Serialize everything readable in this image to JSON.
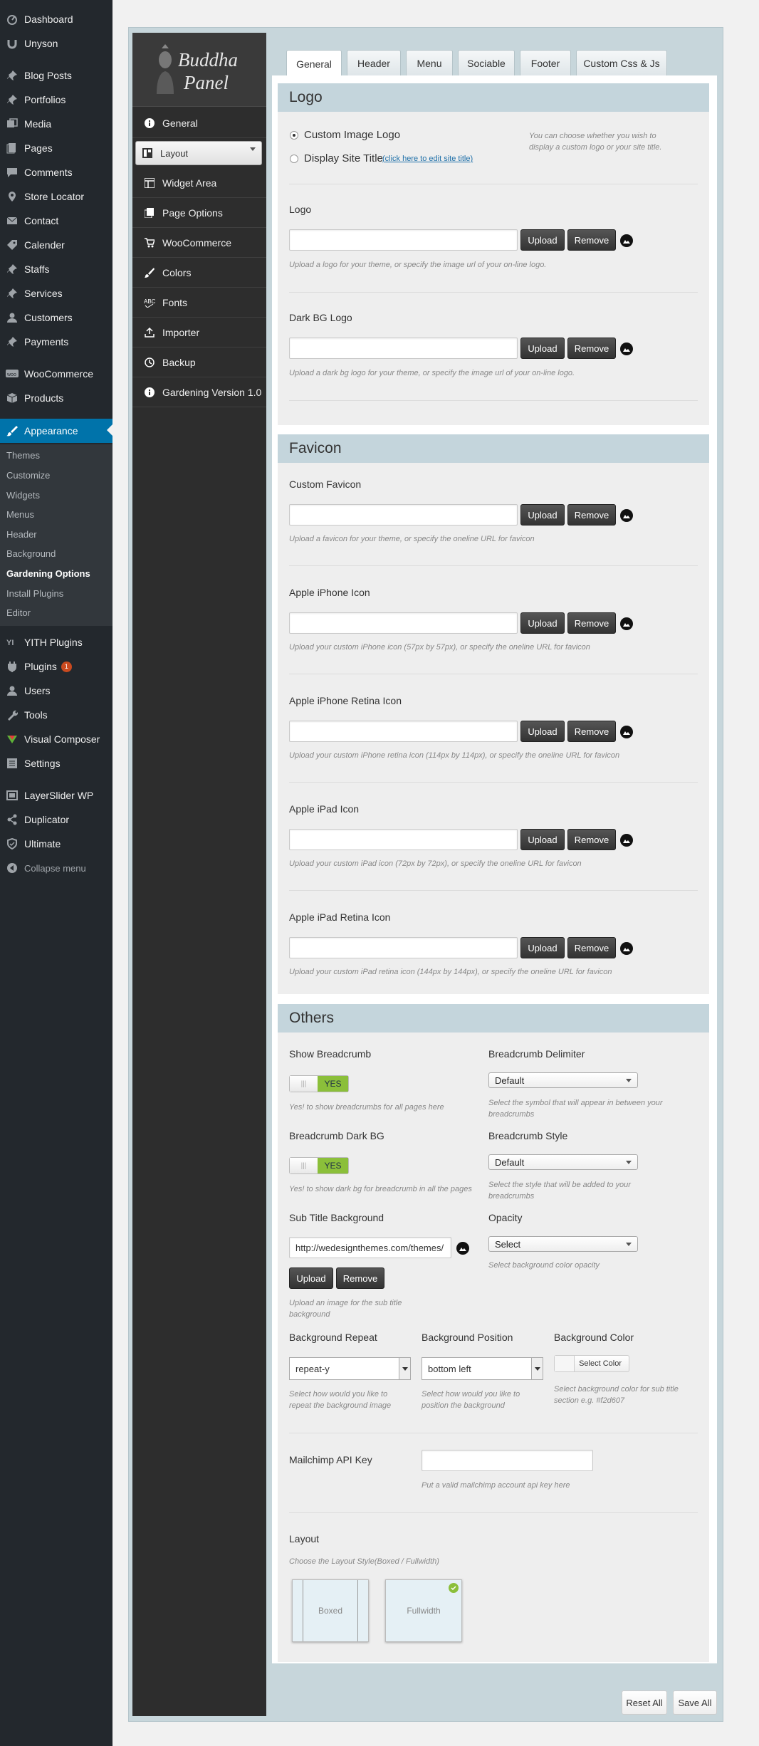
{
  "wp_menu": {
    "items": [
      {
        "label": "Dashboard",
        "icon": "dashboard-icon"
      },
      {
        "label": "Unyson",
        "icon": "unyson-icon"
      },
      {
        "label": "Blog Posts",
        "icon": "pin-icon"
      },
      {
        "label": "Portfolios",
        "icon": "portfolio-icon"
      },
      {
        "label": "Media",
        "icon": "media-icon"
      },
      {
        "label": "Pages",
        "icon": "pages-icon"
      },
      {
        "label": "Comments",
        "icon": "comments-icon"
      },
      {
        "label": "Store Locator",
        "icon": "location-icon"
      },
      {
        "label": "Contact",
        "icon": "email-icon"
      },
      {
        "label": "Calender",
        "icon": "tag-icon"
      },
      {
        "label": "Staffs",
        "icon": "pin-icon"
      },
      {
        "label": "Services",
        "icon": "pin-icon"
      },
      {
        "label": "Customers",
        "icon": "users-icon"
      },
      {
        "label": "Payments",
        "icon": "pin-icon"
      },
      {
        "label": "WooCommerce",
        "icon": "woocommerce-icon"
      },
      {
        "label": "Products",
        "icon": "products-icon"
      },
      {
        "label": "Appearance",
        "icon": "brush-icon"
      }
    ],
    "submenu": [
      "Themes",
      "Customize",
      "Widgets",
      "Menus",
      "Header",
      "Background",
      "Gardening Options",
      "Install Plugins",
      "Editor"
    ],
    "items_after": [
      {
        "label": "YITH Plugins",
        "icon": "yith-icon"
      },
      {
        "label": "Plugins",
        "icon": "plugins-icon",
        "badge": "1"
      },
      {
        "label": "Users",
        "icon": "users-icon"
      },
      {
        "label": "Tools",
        "icon": "tools-icon"
      },
      {
        "label": "Visual Composer",
        "icon": "visual-composer-icon"
      },
      {
        "label": "Settings",
        "icon": "settings-icon"
      },
      {
        "label": "LayerSlider WP",
        "icon": "layers-icon"
      },
      {
        "label": "Duplicator",
        "icon": "duplicator-icon"
      },
      {
        "label": "Ultimate",
        "icon": "ultimate-icon"
      },
      {
        "label": "Collapse menu",
        "icon": "collapse-icon"
      }
    ]
  },
  "panel": {
    "logo_line1": "Buddha",
    "logo_line2": "Panel",
    "nav": [
      {
        "label": "General",
        "icon": "info-icon"
      },
      {
        "label": "Layout",
        "icon": "layout-icon"
      },
      {
        "label": "Widget Area",
        "icon": "widget-icon"
      },
      {
        "label": "Page Options",
        "icon": "page-icon"
      },
      {
        "label": "WooCommerce",
        "icon": "cart-icon"
      },
      {
        "label": "Colors",
        "icon": "brush-icon"
      },
      {
        "label": "Fonts",
        "icon": "fonts-icon"
      },
      {
        "label": "Importer",
        "icon": "upload-icon"
      },
      {
        "label": "Backup",
        "icon": "backup-icon"
      },
      {
        "label": "Gardening Version 1.0",
        "icon": "info-icon"
      }
    ]
  },
  "tabs": [
    "General",
    "Header",
    "Menu",
    "Sociable",
    "Footer",
    "Custom Css & Js"
  ],
  "logo_section": {
    "title": "Logo",
    "radio1": "Custom Image Logo",
    "radio2": "Display Site Title",
    "radio2_link": "(click here to edit site title)",
    "radio_hint": "You can choose whether you wish to display a custom logo or your site title.",
    "fields": [
      {
        "label": "Logo",
        "hint": "Upload a logo for your theme, or specify the image url of your on-line logo."
      },
      {
        "label": "Dark BG Logo",
        "hint": "Upload a dark bg logo for your theme, or specify the image url of your on-line logo."
      }
    ]
  },
  "buttons": {
    "upload": "Upload",
    "remove": "Remove"
  },
  "favicon_section": {
    "title": "Favicon",
    "fields": [
      {
        "label": "Custom Favicon",
        "hint": "Upload a favicon for your theme, or specify the oneline URL for favicon"
      },
      {
        "label": "Apple iPhone Icon",
        "hint": "Upload your custom iPhone icon (57px by 57px), or specify the oneline URL for favicon"
      },
      {
        "label": "Apple iPhone Retina Icon",
        "hint": "Upload your custom iPhone retina icon (114px by 114px), or specify the oneline URL for favicon"
      },
      {
        "label": "Apple iPad Icon",
        "hint": "Upload your custom iPad icon (72px by 72px), or specify the oneline URL for favicon"
      },
      {
        "label": "Apple iPad Retina Icon",
        "hint": "Upload your custom iPad retina icon (144px by 144px), or specify the oneline URL for favicon"
      }
    ]
  },
  "others": {
    "title": "Others",
    "show_breadcrumb": {
      "label": "Show Breadcrumb",
      "toggle": "YES",
      "hint": "Yes! to show breadcrumbs for all pages here"
    },
    "breadcrumb_delimiter": {
      "label": "Breadcrumb Delimiter",
      "value": "Default",
      "hint": "Select the symbol that will appear in between your breadcrumbs"
    },
    "breadcrumb_dark": {
      "label": "Breadcrumb Dark BG",
      "toggle": "YES",
      "hint": "Yes! to show dark bg for breadcrumb in all the pages"
    },
    "breadcrumb_style": {
      "label": "Breadcrumb Style",
      "value": "Default",
      "hint": "Select the style that will be added to your breadcrumbs"
    },
    "subtitle_bg": {
      "label": "Sub Title Background",
      "value": "http://wedesignthemes.com/themes/",
      "hint": "Upload an image for the sub title background"
    },
    "opacity": {
      "label": "Opacity",
      "value": "Select",
      "hint": "Select background color opacity"
    },
    "bg_repeat": {
      "label": "Background Repeat",
      "value": "repeat-y",
      "hint": "Select how would you like to repeat the background image"
    },
    "bg_position": {
      "label": "Background Position",
      "value": "bottom left",
      "hint": "Select how would you like to position the background"
    },
    "bg_color": {
      "label": "Background Color",
      "button": "Select Color",
      "hint": "Select background color for sub title section e.g. #f2d607"
    },
    "mailchimp": {
      "label": "Mailchimp API Key",
      "hint": "Put a valid mailchimp account api key here"
    },
    "layout": {
      "label": "Layout",
      "hint": "Choose the Layout Style(Boxed / Fullwidth)",
      "boxed": "Boxed",
      "fullwidth": "Fullwidth"
    }
  },
  "footer_buttons": {
    "reset": "Reset All",
    "save": "Save All"
  },
  "colors": {
    "wp_active": "#0073aa",
    "yes_green": "#8bbf3a",
    "section_header": "#c4d5dc"
  }
}
